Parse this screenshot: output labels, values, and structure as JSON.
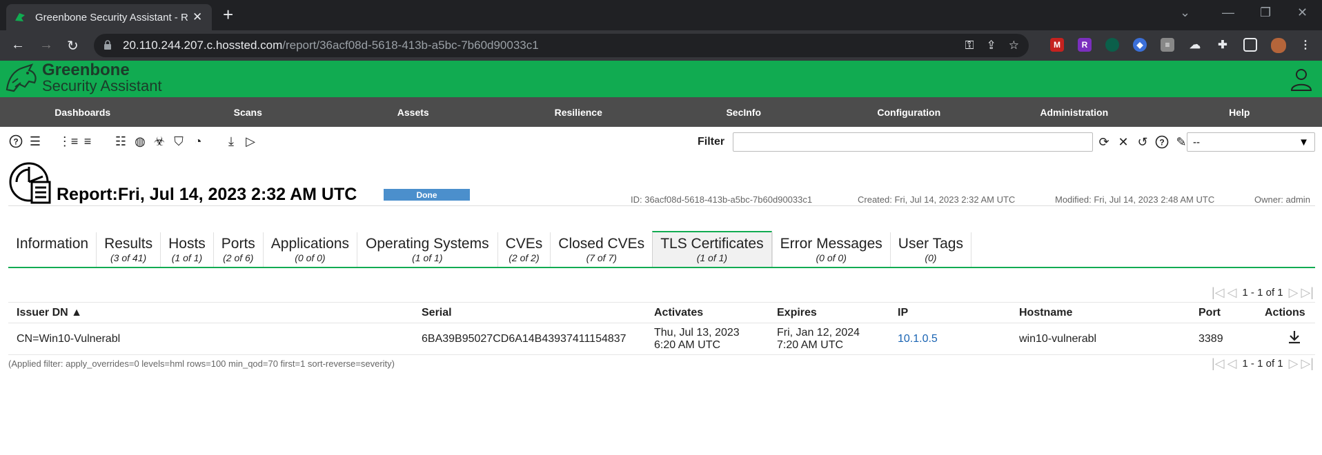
{
  "browser": {
    "tab_title": "Greenbone Security Assistant - R",
    "url_host": "20.110.244.207.c.hossted.com",
    "url_path": "/report/36acf08d-5618-413b-a5bc-7b60d90033c1"
  },
  "app": {
    "name_line1": "Greenbone",
    "name_line2": "Security Assistant",
    "brand_color": "#11ab51"
  },
  "nav": {
    "items": [
      "Dashboards",
      "Scans",
      "Assets",
      "Resilience",
      "SecInfo",
      "Configuration",
      "Administration",
      "Help"
    ]
  },
  "filter": {
    "label": "Filter",
    "value": "",
    "select_value": "--"
  },
  "report": {
    "title": "Report:Fri, Jul 14, 2023 2:32 AM UTC",
    "status": "Done",
    "id": "ID: 36acf08d-5618-413b-a5bc-7b60d90033c1",
    "created": "Created: Fri, Jul 14, 2023 2:32 AM UTC",
    "modified": "Modified: Fri, Jul 14, 2023 2:48 AM UTC",
    "owner": "Owner: admin"
  },
  "tabs": [
    {
      "label": "Information",
      "count": ""
    },
    {
      "label": "Results",
      "count": "(3 of 41)"
    },
    {
      "label": "Hosts",
      "count": "(1 of 1)"
    },
    {
      "label": "Ports",
      "count": "(2 of 6)"
    },
    {
      "label": "Applications",
      "count": "(0 of 0)"
    },
    {
      "label": "Operating Systems",
      "count": "(1 of 1)"
    },
    {
      "label": "CVEs",
      "count": "(2 of 2)"
    },
    {
      "label": "Closed CVEs",
      "count": "(7 of 7)"
    },
    {
      "label": "TLS Certificates",
      "count": "(1 of 1)"
    },
    {
      "label": "Error Messages",
      "count": "(0 of 0)"
    },
    {
      "label": "User Tags",
      "count": "(0)"
    }
  ],
  "pagination": {
    "text": "1 - 1 of 1"
  },
  "table": {
    "headers": {
      "issuer": "Issuer DN ▲",
      "serial": "Serial",
      "activates": "Activates",
      "expires": "Expires",
      "ip": "IP",
      "hostname": "Hostname",
      "port": "Port",
      "actions": "Actions"
    },
    "rows": [
      {
        "issuer": "CN=Win10-Vulnerabl",
        "serial": "6BA39B95027CD6A14B43937411154837",
        "activates_date": "Thu, Jul 13, 2023",
        "activates_time": "6:20 AM UTC",
        "expires_date": "Fri, Jan 12, 2024",
        "expires_time": "7:20 AM UTC",
        "ip": "10.1.0.5",
        "hostname": "win10-vulnerabl",
        "port": "3389"
      }
    ]
  },
  "applied_filter": "(Applied filter: apply_overrides=0 levels=hml rows=100 min_qod=70 first=1 sort-reverse=severity)"
}
